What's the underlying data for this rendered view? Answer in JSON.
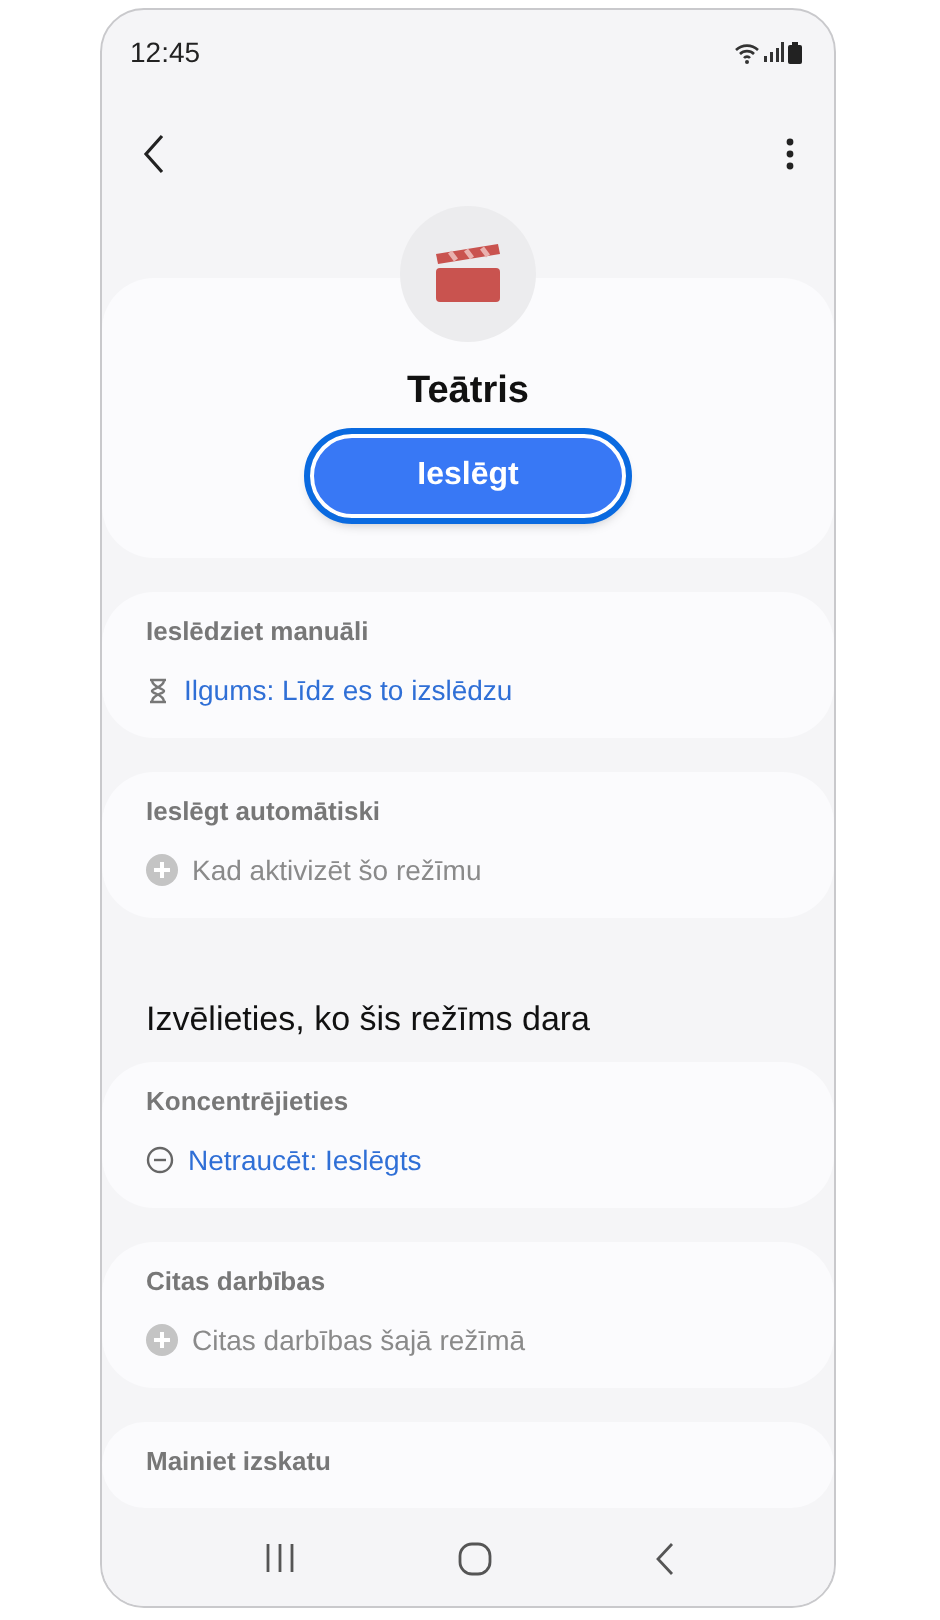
{
  "status_bar": {
    "time": "12:45"
  },
  "mode": {
    "title": "Teātris",
    "button": "Ieslēgt"
  },
  "sections": [
    {
      "title": "Ieslēdziet manuāli",
      "item": {
        "kind": "duration",
        "label": "Ilgums: Līdz es to izslēdzu"
      }
    },
    {
      "title": "Ieslēgt automātiski",
      "item": {
        "kind": "add",
        "label": "Kad aktivizēt šo režīmu"
      }
    },
    {
      "kind": "heading",
      "title": "Izvēlieties, ko šis režīms dara"
    },
    {
      "title": "Koncentrējieties",
      "item": {
        "kind": "dnd",
        "label": "Netraucēt: Ieslēgts"
      }
    },
    {
      "title": "Citas darbības",
      "item": {
        "kind": "add",
        "label": "Citas darbības šajā režīmā"
      }
    },
    {
      "title": "Mainiet izskatu"
    }
  ]
}
